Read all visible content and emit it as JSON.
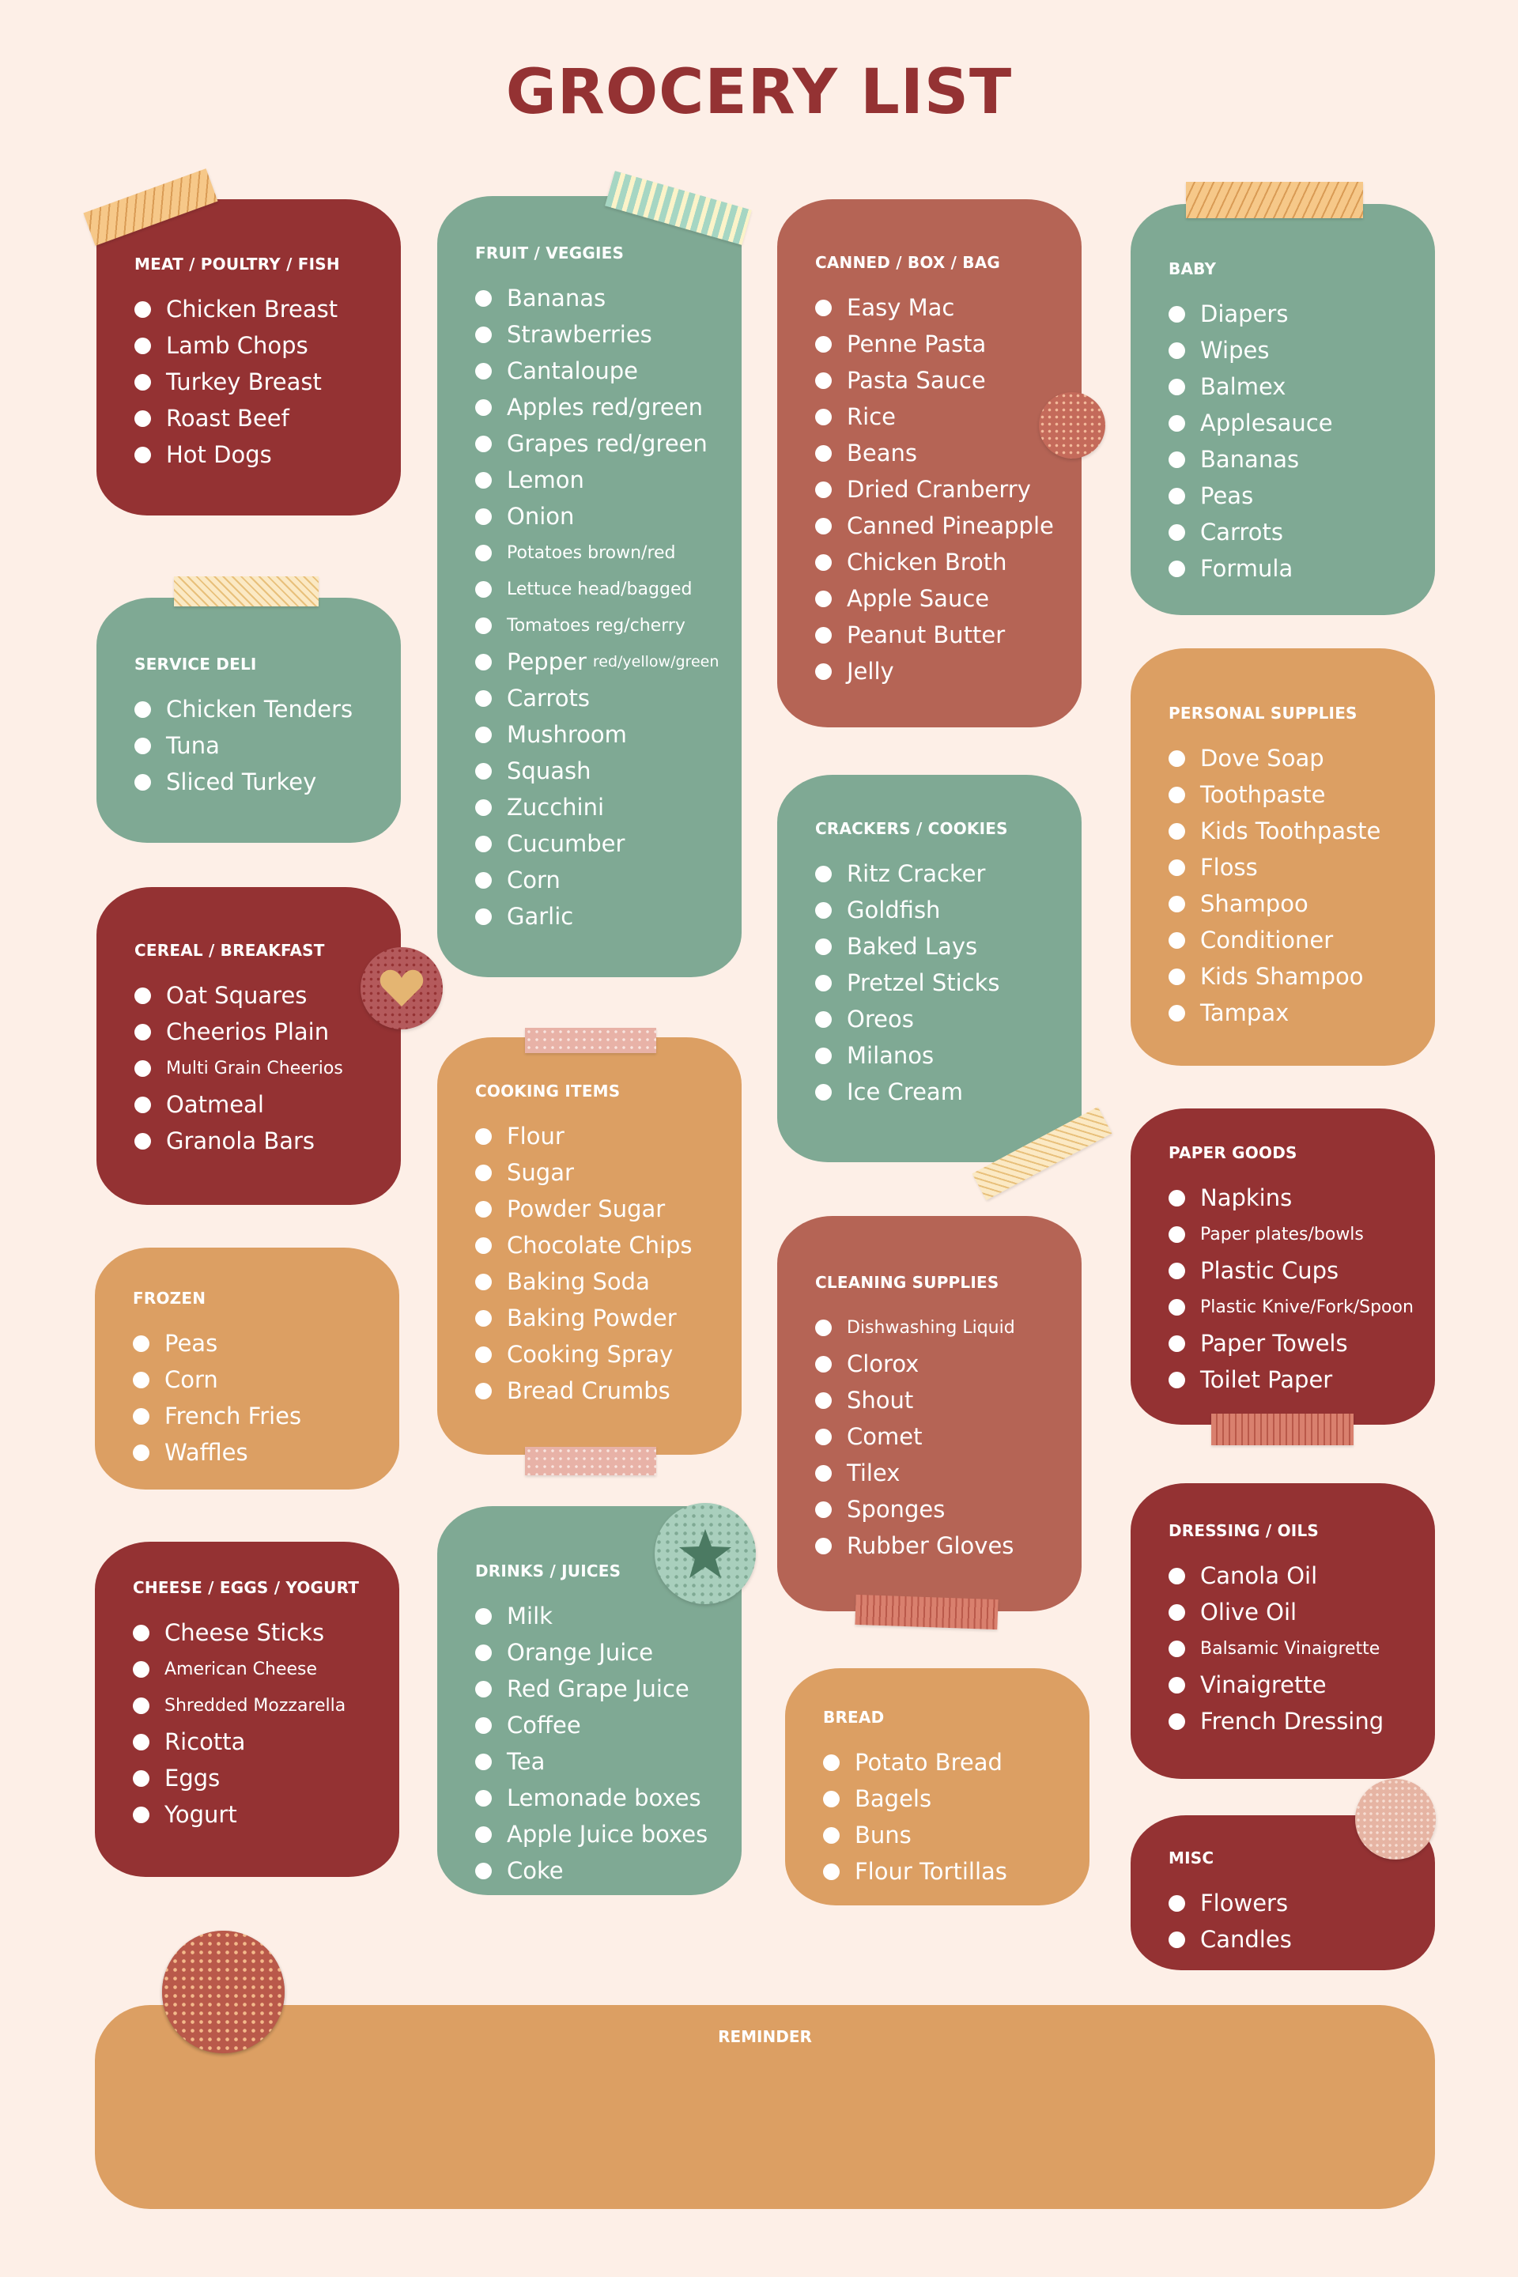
{
  "title": "GROCERY LIST",
  "colors": {
    "background": "#fdefe7",
    "title": "#943233",
    "red": "#943233",
    "green": "#7fa994",
    "rust": "#b56455",
    "orange": "#dc9f63"
  },
  "sections": {
    "meat": {
      "title": "MEAT / POULTRY / FISH",
      "items": [
        "Chicken Breast",
        "Lamb Chops",
        "Turkey Breast",
        "Roast Beef",
        "Hot Dogs"
      ]
    },
    "deli": {
      "title": "SERVICE DELI",
      "items": [
        "Chicken Tenders",
        "Tuna",
        "Sliced Turkey"
      ]
    },
    "cereal": {
      "title": "CEREAL / BREAKFAST",
      "items": [
        "Oat Squares",
        "Cheerios Plain",
        "Multi Grain Cheerios",
        "Oatmeal",
        "Granola Bars"
      ]
    },
    "frozen": {
      "title": "FROZEN",
      "items": [
        "Peas",
        "Corn",
        "French Fries",
        "Waffles"
      ]
    },
    "cheese": {
      "title": "CHEESE / EGGS / YOGURT",
      "items": [
        "Cheese Sticks",
        "American Cheese",
        "Shredded Mozzarella",
        "Ricotta",
        "Eggs",
        "Yogurt"
      ]
    },
    "fruit": {
      "title": "FRUIT / VEGGIES",
      "items": [
        "Bananas",
        "Strawberries",
        "Cantaloupe",
        "Apples red/green",
        "Grapes red/green",
        "Lemon",
        "Onion",
        "Potatoes brown/red",
        "Lettuce head/bagged",
        "Tomatoes reg/cherry",
        "Pepper",
        "Carrots",
        "Mushroom",
        "Squash",
        "Zucchini",
        "Cucumber",
        "Corn",
        "Garlic"
      ],
      "pepper_note": "red/yellow/green"
    },
    "cooking": {
      "title": "COOKING ITEMS",
      "items": [
        "Flour",
        "Sugar",
        "Powder Sugar",
        "Chocolate Chips",
        "Baking Soda",
        "Baking Powder",
        "Cooking Spray",
        "Bread Crumbs"
      ]
    },
    "drinks": {
      "title": "DRINKS / JUICES",
      "items": [
        "Milk",
        "Orange Juice",
        "Red Grape Juice",
        "Coffee",
        "Tea",
        "Lemonade boxes",
        "Apple Juice boxes",
        "Coke"
      ]
    },
    "canned": {
      "title": "CANNED / BOX / BAG",
      "items": [
        "Easy Mac",
        "Penne Pasta",
        "Pasta Sauce",
        "Rice",
        "Beans",
        "Dried Cranberry",
        "Canned Pineapple",
        "Chicken Broth",
        "Apple Sauce",
        "Peanut Butter",
        "Jelly"
      ]
    },
    "crackers": {
      "title": "CRACKERS / COOKIES",
      "items": [
        "Ritz Cracker",
        "Goldfish",
        "Baked Lays",
        "Pretzel Sticks",
        "Oreos",
        "Milanos",
        "Ice Cream"
      ]
    },
    "cleaning": {
      "title": "CLEANING SUPPLIES",
      "items": [
        "Dishwashing Liquid",
        "Clorox",
        "Shout",
        "Comet",
        "Tilex",
        "Sponges",
        "Rubber Gloves"
      ]
    },
    "bread": {
      "title": "BREAD",
      "items": [
        "Potato Bread",
        "Bagels",
        "Buns",
        "Flour Tortillas"
      ]
    },
    "baby": {
      "title": "BABY",
      "items": [
        "Diapers",
        "Wipes",
        "Balmex",
        "Applesauce",
        "Bananas",
        "Peas",
        "Carrots",
        "Formula"
      ]
    },
    "personal": {
      "title": "PERSONAL SUPPLIES",
      "items": [
        "Dove Soap",
        "Toothpaste",
        "Kids Toothpaste",
        "Floss",
        "Shampoo",
        "Conditioner",
        "Kids Shampoo",
        "Tampax"
      ]
    },
    "paper": {
      "title": "PAPER GOODS",
      "items": [
        "Napkins",
        "Paper plates/bowls",
        "Plastic Cups",
        "Plastic Knive/Fork/Spoon",
        "Paper Towels",
        "Toilet Paper"
      ]
    },
    "dressing": {
      "title": "DRESSING / OILS",
      "items": [
        "Canola Oil",
        "Olive Oil",
        "Balsamic Vinaigrette",
        "Vinaigrette",
        "French Dressing"
      ]
    },
    "misc": {
      "title": "MISC",
      "items": [
        "Flowers",
        "Candles"
      ]
    }
  },
  "reminder": {
    "title": "REMINDER"
  },
  "icons": {
    "heart": "heart-icon",
    "star": "star-icon"
  }
}
